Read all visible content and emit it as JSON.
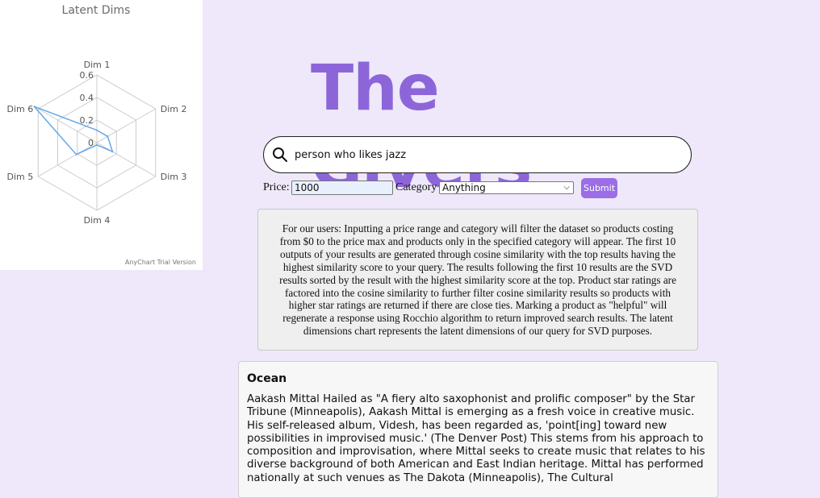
{
  "chart_data": {
    "type": "radar",
    "title": "Latent Dims",
    "axes": [
      "Dim 1",
      "Dim 2",
      "Dim 3",
      "Dim 4",
      "Dim 5",
      "Dim 6"
    ],
    "tick_labels": [
      "0",
      "0.2",
      "0.4",
      "0.6"
    ],
    "ylim": [
      0,
      0.6
    ],
    "series": [
      {
        "values": [
          0.11,
          0.11,
          0.16,
          0.02,
          0.21,
          0.64
        ]
      }
    ],
    "grid": true,
    "credits": "AnyChart Trial Version",
    "colors": {
      "series": "#64a8e8",
      "grid": "#cccccc"
    }
  },
  "header": {
    "title": "The Givers",
    "title_color": "#8c66d9"
  },
  "search": {
    "value": "person who likes jazz",
    "icon": "search-icon"
  },
  "filters": {
    "price_label": "Price:",
    "price_value": "1000",
    "category_label": "Category",
    "category_selected": "Anything",
    "submit_label": "Submit"
  },
  "info": {
    "text": "For our users: Inputting a price range and category will filter the dataset so products costing from $0 to the price max and products only in the specified category will appear. The first 10 outputs of your results are generated through cosine similarity with the top results having the highest similarity score to your query. The results following the first 10 results are the SVD results sorted by the result with the highest similarity score at the top. Product star ratings are factored into the cosine similarity to further filter cosine similarity results so products with higher star ratings are returned if there are close ties. Marking a product as \"helpful\" will regenerate a response using Rocchio algorithm to return improved search results. The latent dimensions chart represents the latent dimensions of our query for SVD purposes."
  },
  "results": [
    {
      "title": "Ocean",
      "description": "Aakash Mittal Hailed as \"A fiery alto saxophonist and prolific composer\" by the Star Tribune (Minneapolis), Aakash Mittal is emerging as a fresh voice in creative music. His self-released album, Videsh, has been regarded as, 'point[ing] toward new possibilities in improvised music.' (The Denver Post) This stems from his approach to composition and improvisation, where Mittal seeks to create music that relates to his diverse background of both American and East Indian heritage. Mittal has performed nationally at such venues as The Dakota (Minneapolis), The Cultural"
    }
  ]
}
